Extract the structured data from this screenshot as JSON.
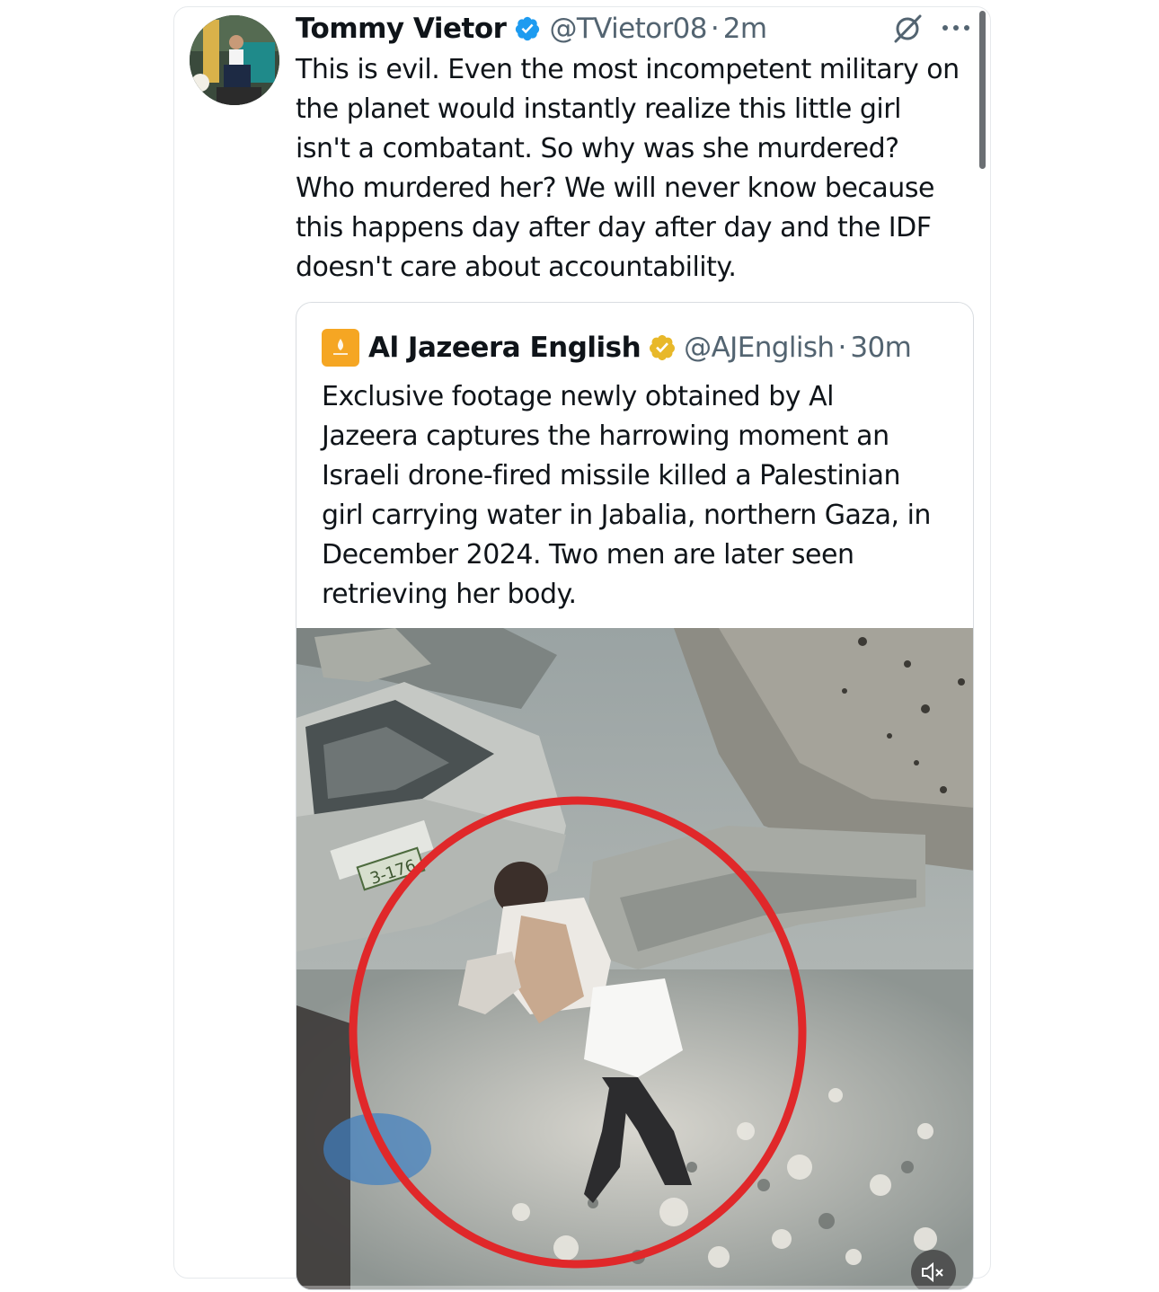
{
  "tweet": {
    "author_name": "Tommy Vietor",
    "handle": "@TVietor08",
    "separator": "·",
    "time": "2m",
    "text": "This is evil. Even the most incompetent military on\nthe planet would instantly realize this little girl\nisn't a combatant. So why was she murdered?\nWho murdered her? We will never know because\nthis happens day after day after day and the IDF\ndoesn't care about accountability.",
    "verified_badge_color": "#1d9bf0",
    "icons": [
      "verified-icon",
      "grok-icon",
      "more-icon"
    ]
  },
  "quoted_tweet": {
    "author_name": "Al Jazeera English",
    "handle": "@AJEnglish",
    "separator": "·",
    "time": "30m",
    "text": "Exclusive footage newly obtained by Al\nJazeera captures the harrowing moment an\nIsraeli drone-fired missile killed a Palestinian\ngirl carrying water in Jabalia, northern Gaza, in\nDecember 2024. Two men are later seen\nretrieving her body.",
    "verified_badge_color": "#e8b829",
    "logo_color": "#f5a623",
    "media": {
      "type": "video",
      "plate_text": "3-176",
      "icons": [
        "mute-icon"
      ]
    }
  }
}
